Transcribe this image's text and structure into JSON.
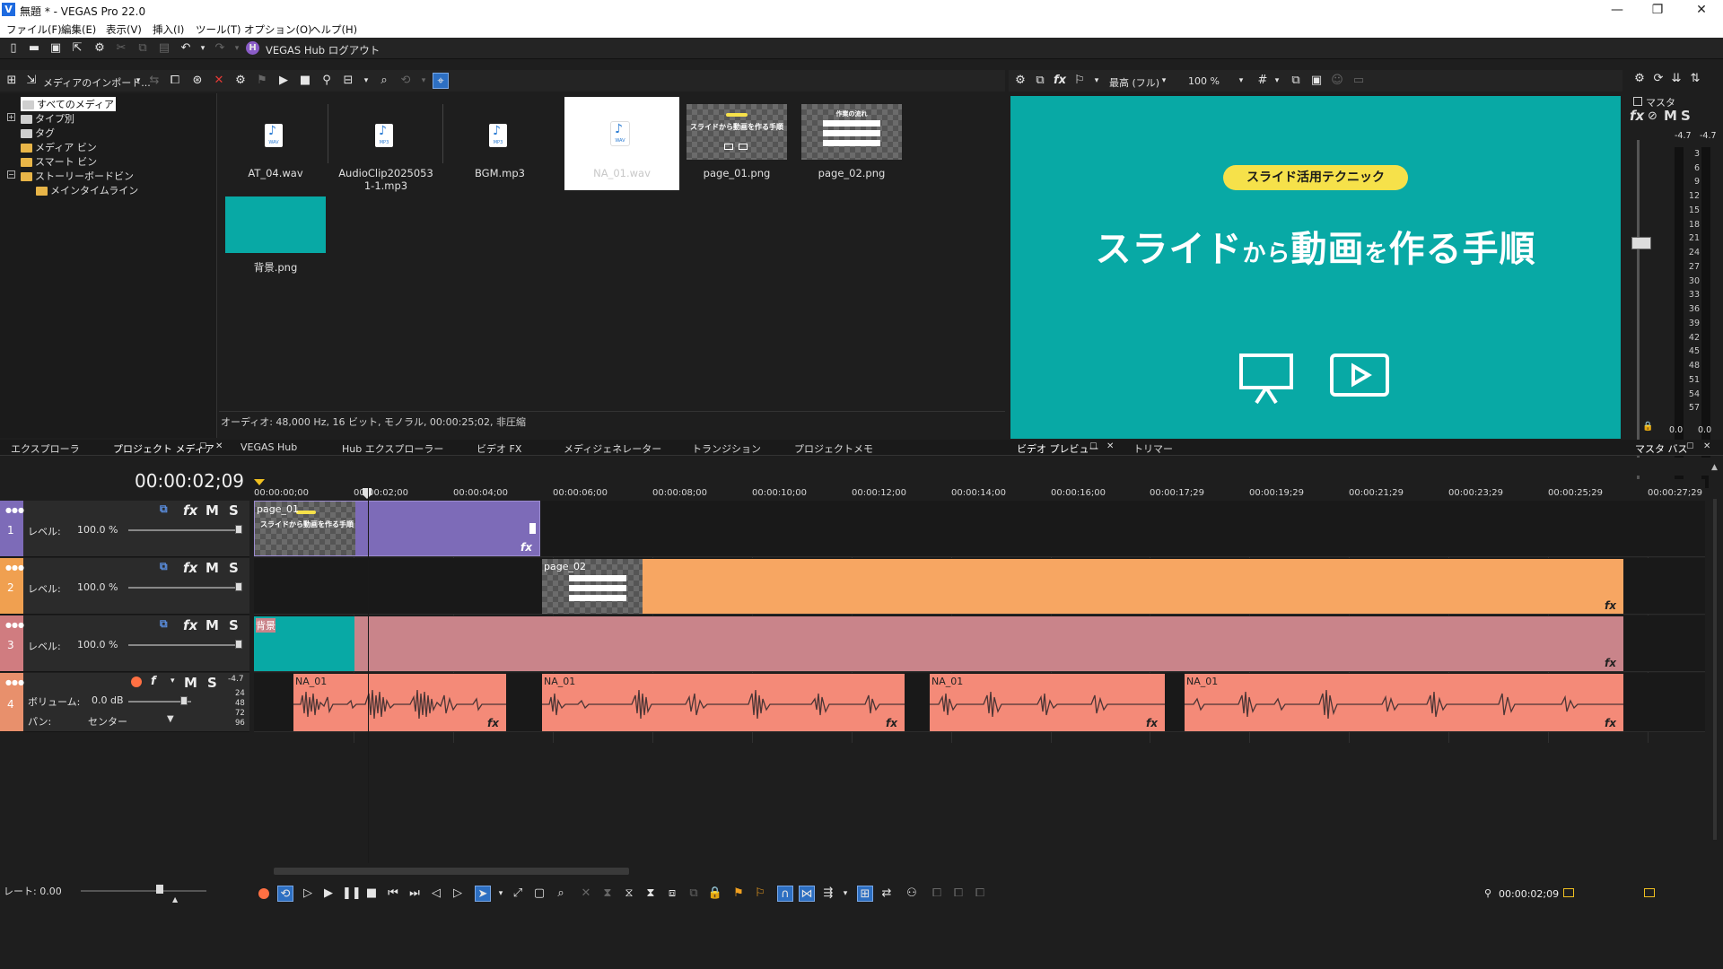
{
  "window": {
    "title": "無題 * - VEGAS Pro 22.0",
    "app_icon_letter": "V",
    "minimize": "—",
    "maximize": "❐",
    "close": "✕"
  },
  "menu": [
    "ファイル(F)",
    "編集(E)",
    "表示(V)",
    "挿入(I)",
    "ツール(T)",
    "オプション(O)",
    "ヘルプ(H)"
  ],
  "toolbar": {
    "hub_badge": "H",
    "hub_label": "VEGAS Hub ログアウト"
  },
  "media_toolbar": {
    "import_label": "メディアのインポート..."
  },
  "tree": {
    "items": [
      "すべてのメディア",
      "タイプ別",
      "タグ",
      "メディア ビン",
      "スマート ビン",
      "ストーリーボードビン",
      "メインタイムライン"
    ]
  },
  "media_items": [
    {
      "name": "AT_04.wav",
      "fmt": "WAV"
    },
    {
      "name": "AudioClip20250531-1.mp3",
      "fmt": "MP3"
    },
    {
      "name": "BGM.mp3",
      "fmt": "MP3"
    },
    {
      "name": "NA_01.wav",
      "fmt": "WAV"
    },
    {
      "name": "page_01.png"
    },
    {
      "name": "page_02.png"
    },
    {
      "name": "背景.png"
    }
  ],
  "media_status": "オーディオ: 48,000 Hz, 16 ビット, モノラル, 00:00:25;02, 非圧縮",
  "tabs": [
    "エクスプローラ",
    "プロジェクト メディア",
    "VEGAS Hub",
    "Hub エクスプローラー",
    "ビデオ FX",
    "メディジェネレーター",
    "トランジション",
    "プロジェクトメモ",
    "ビデオ プレビュー",
    "トリマー",
    "マスタ バス"
  ],
  "preview_toolbar": {
    "quality": "最高 (フル)",
    "zoom": "100 %"
  },
  "preview": {
    "badge": "スライド活用テクニック",
    "headline_a": "スライド",
    "headline_b": "から",
    "headline_c": "動画",
    "headline_d": "を",
    "headline_e": "作る手順"
  },
  "master": {
    "title": "マスタ",
    "fx": "fx",
    "m": "M",
    "s": "S",
    "peak_l": "-4.7",
    "peak_r": "-4.7",
    "scale": [
      "3",
      "6",
      "9",
      "12",
      "15",
      "18",
      "21",
      "24",
      "27",
      "30",
      "33",
      "36",
      "39",
      "42",
      "45",
      "48",
      "51",
      "54",
      "57"
    ],
    "bottom_l": "0.0",
    "bottom_r": "0.0"
  },
  "timeline": {
    "timecode": "00:00:02;09",
    "ruler": [
      "00:00:00;00",
      "00:00:02;00",
      "00:00:04;00",
      "00:00:06;00",
      "00:00:08;00",
      "00:00:10;00",
      "00:00:12;00",
      "00:00:14;00",
      "00:00:16;00",
      "00:00:17;29",
      "00:00:19;29",
      "00:00:21;29",
      "00:00:23;29",
      "00:00:25;29",
      "00:00:27;29"
    ],
    "tracks": [
      {
        "label": "レベル:",
        "value": "100.0 %",
        "color": "#7d6bb8"
      },
      {
        "label": "レベル:",
        "value": "100.0 %",
        "color": "#f0a050"
      },
      {
        "label": "レベル:",
        "value": "100.0 %",
        "color": "#d07c80"
      }
    ],
    "audio_track": {
      "volume_label": "ボリューム:",
      "volume": "0.0 dB",
      "pan_label": "パン:",
      "pan": "センター",
      "meter_peak": "-4.7",
      "meter_scale": [
        "24",
        "48",
        "72",
        "96"
      ]
    },
    "clips": {
      "page01": "page_01",
      "page01_thumb": "スライドから動画を作る手順",
      "page02": "page_02",
      "page02_thumb": "作業の流れ",
      "bg": "背景",
      "na": "NA_01"
    },
    "rate_label": "レート: 0.00",
    "end_timecode": "00:00:02;09"
  }
}
